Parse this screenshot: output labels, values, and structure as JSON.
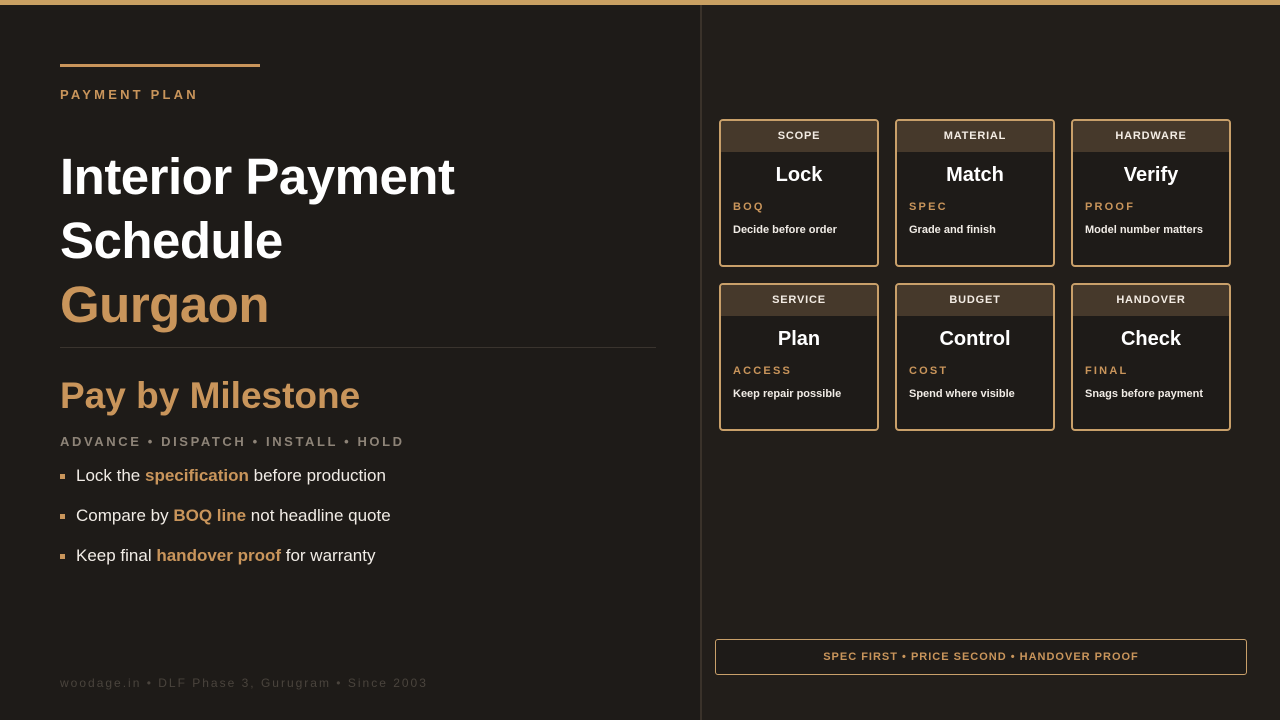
{
  "kicker": "PAYMENT PLAN",
  "title": {
    "line1": "Interior Payment",
    "line2": "Schedule",
    "city": "Gurgaon"
  },
  "subtitle": "Pay by Milestone",
  "steps": "ADVANCE • DISPATCH • INSTALL • HOLD",
  "bullets": [
    {
      "pre": "Lock the ",
      "highlight": "specification",
      "post": " before production"
    },
    {
      "pre": "Compare by ",
      "highlight": "BOQ line",
      "post": " not headline quote"
    },
    {
      "pre": "Keep final ",
      "highlight": "handover proof",
      "post": " for warranty"
    }
  ],
  "footer": "woodage.in • DLF Phase 3, Gurugram • Since 2003",
  "cards": [
    {
      "head": "SCOPE",
      "big": "Lock",
      "tag": "BOQ",
      "desc": "Decide before order"
    },
    {
      "head": "MATERIAL",
      "big": "Match",
      "tag": "SPEC",
      "desc": "Grade and finish"
    },
    {
      "head": "HARDWARE",
      "big": "Verify",
      "tag": "PROOF",
      "desc": "Model number matters"
    },
    {
      "head": "SERVICE",
      "big": "Plan",
      "tag": "ACCESS",
      "desc": "Keep repair possible"
    },
    {
      "head": "BUDGET",
      "big": "Control",
      "tag": "COST",
      "desc": "Spend where visible"
    },
    {
      "head": "HANDOVER",
      "big": "Check",
      "tag": "FINAL",
      "desc": "Snags before payment"
    }
  ],
  "banner": "SPEC FIRST • PRICE SECOND • HANDOVER PROOF",
  "colors": {
    "accent": "#c9955b",
    "background": "#1e1b18",
    "card_header": "#46392b"
  }
}
